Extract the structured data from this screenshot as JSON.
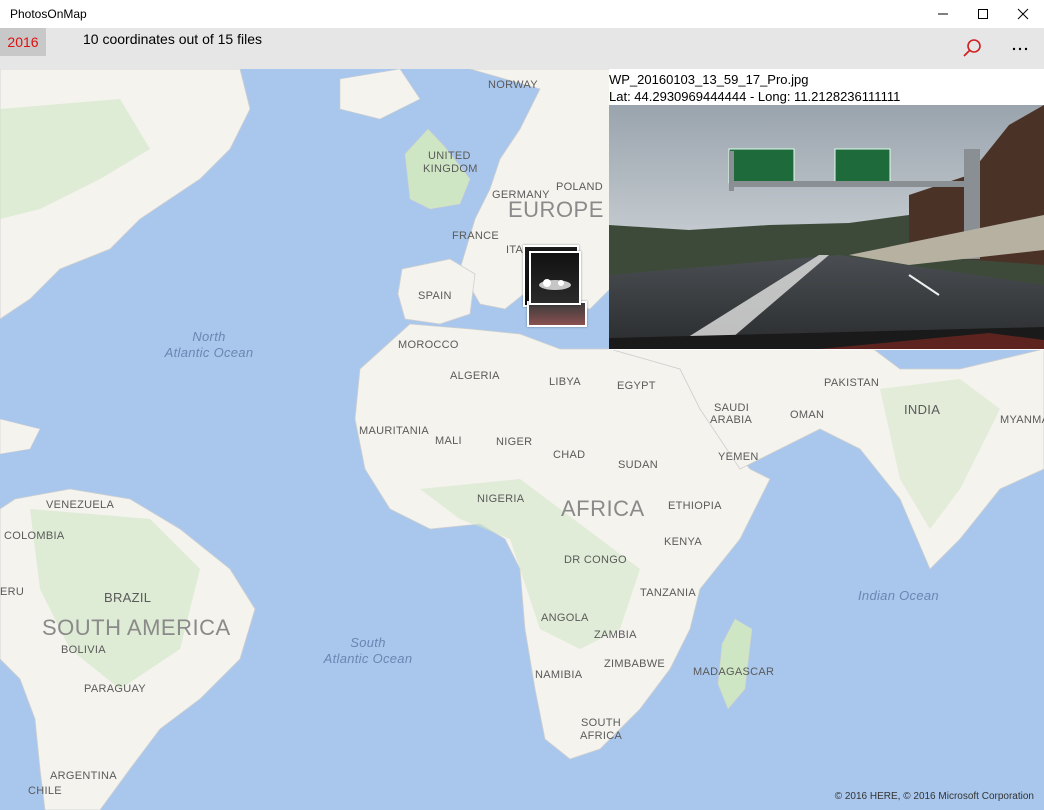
{
  "window": {
    "title": "PhotosOnMap"
  },
  "commandbar": {
    "year": "2016",
    "status": "10 coordinates out of 15 files",
    "search_icon": "search-icon",
    "more_label": "···"
  },
  "preview": {
    "filename": "WP_20160103_13_59_17_Pro.jpg",
    "coordinates": "Lat: 44.2930969444444 - Long: 11.2128236111111"
  },
  "map": {
    "labels": {
      "norway": "NORWAY",
      "united_kingdom_1": "UNITED",
      "united_kingdom_2": "KINGDOM",
      "germany": "GERMANY",
      "poland": "POLAND",
      "europe": "EUROPE",
      "france": "FRANCE",
      "italy": "ITAL",
      "spain": "SPAIN",
      "morocco": "MOROCCO",
      "algeria": "ALGERIA",
      "libya": "LIBYA",
      "egypt": "EGYPT",
      "pakistan": "PAKISTAN",
      "saudi_1": "SAUDI",
      "saudi_2": "ARABIA",
      "oman": "OMAN",
      "india": "INDIA",
      "myanmar": "MYANMA",
      "mauritania": "MAURITANIA",
      "mali": "MALI",
      "niger": "NIGER",
      "chad": "CHAD",
      "sudan": "SUDAN",
      "yemen": "YEMEN",
      "nigeria": "NIGERIA",
      "africa": "AFRICA",
      "ethiopia": "ETHIOPIA",
      "venezuela": "VENEZUELA",
      "colombia": "COLOMBIA",
      "kenya": "KENYA",
      "dr_congo": "DR CONGO",
      "peru": "ERU",
      "brazil": "BRAZIL",
      "south_america": "SOUTH AMERICA",
      "tanzania": "TANZANIA",
      "angola": "ANGOLA",
      "zambia": "ZAMBIA",
      "bolivia": "BOLIVIA",
      "zimbabwe": "ZIMBABWE",
      "namibia": "NAMIBIA",
      "madagascar": "MADAGASCAR",
      "paraguay": "PARAGUAY",
      "south_africa_1": "SOUTH",
      "south_africa_2": "AFRICA",
      "argentina": "ARGENTINA",
      "chile": "CHILE",
      "north_atlantic_1": "North",
      "north_atlantic_2": "Atlantic Ocean",
      "south_atlantic_1": "South",
      "south_atlantic_2": "Atlantic Ocean",
      "indian_ocean": "Indian Ocean"
    },
    "copyright": "© 2016 HERE, © 2016 Microsoft Corporation"
  },
  "colors": {
    "water": "#a9c7ec",
    "land": "#f4f3ee",
    "green": "#cfe6c4",
    "accent": "#e01010"
  }
}
